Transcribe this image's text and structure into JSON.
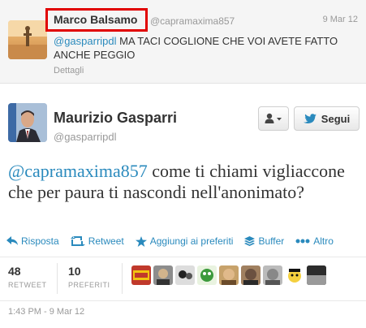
{
  "reply": {
    "name": "Marco Balsamo",
    "handle": "@capramaxima857",
    "date": "9 Mar 12",
    "mention": "@gasparripdl",
    "text": " MA TACI COGLIONE CHE VOI AVETE FATTO ANCHE PEGGIO",
    "details": "Dettagli"
  },
  "tweet": {
    "name": "Maurizio Gasparri",
    "handle": "@gasparripdl",
    "follow_label": "Segui",
    "mention": "@capramaxima857",
    "text": " come ti chiami vigliaccone che per paura ti nascondi nell'anonimato?",
    "timestamp": "1:43 PM - 9 Mar 12"
  },
  "actions": {
    "reply": "Risposta",
    "retweet": "Retweet",
    "favorite": "Aggiungi ai preferiti",
    "buffer": "Buffer",
    "more": "Altro"
  },
  "stats": {
    "retweets_count": "48",
    "retweets_label": "RETWEET",
    "favorites_count": "10",
    "favorites_label": "PREFERITI"
  },
  "colors": {
    "link": "#2a8abd",
    "highlight": "#e10000"
  },
  "icons": {
    "user_menu": "user-dropdown-icon",
    "follow": "twitter-bird-icon",
    "reply": "reply-arrow-icon",
    "retweet": "retweet-icon",
    "favorite": "star-icon",
    "buffer": "buffer-stack-icon",
    "more": "dots-icon"
  }
}
